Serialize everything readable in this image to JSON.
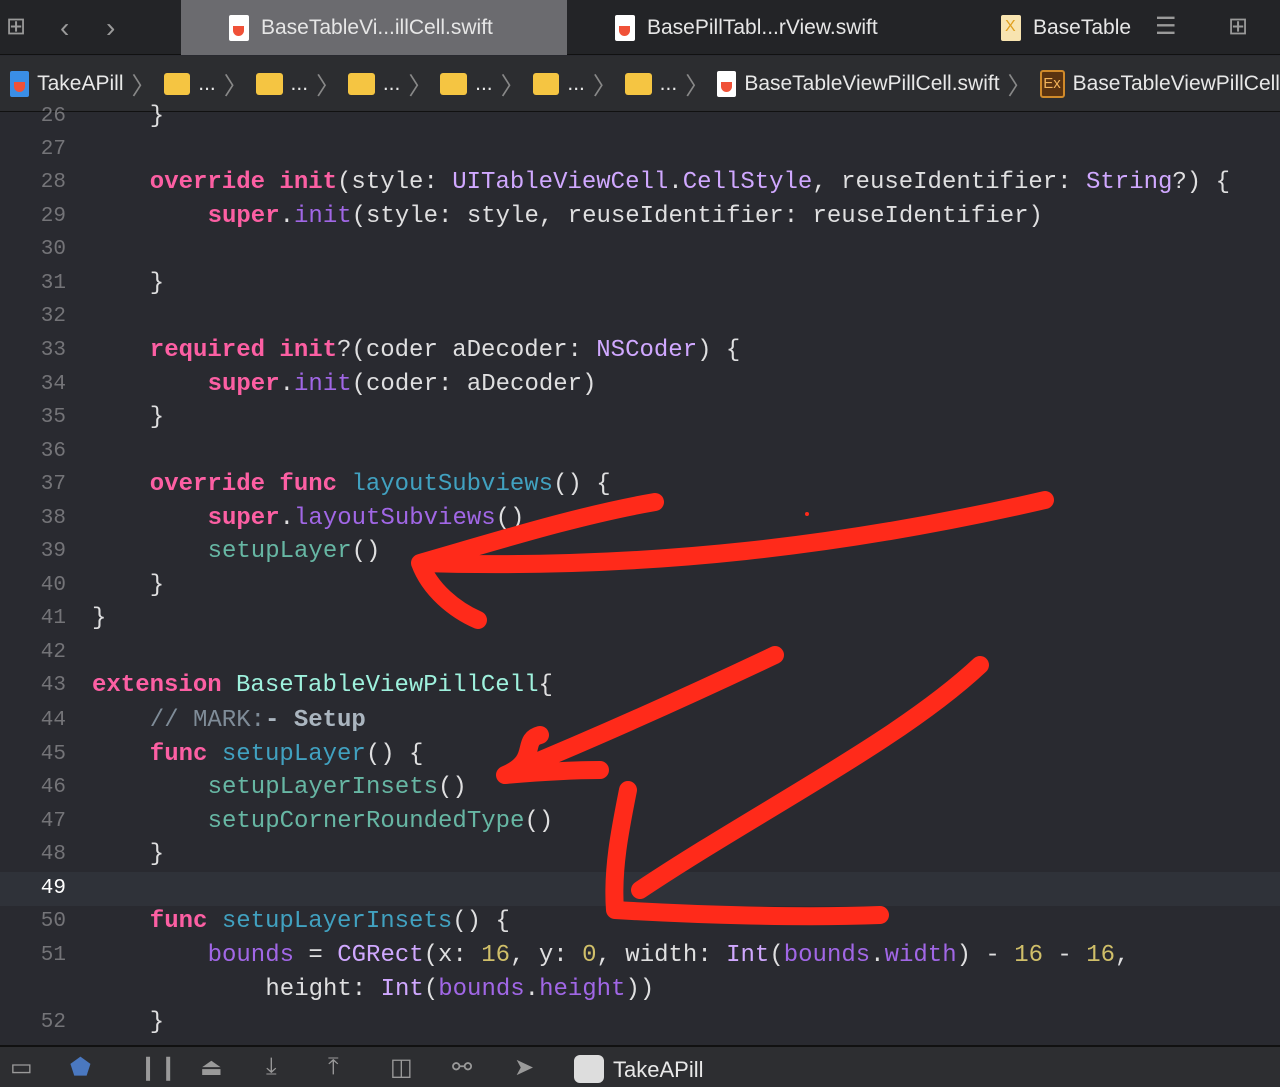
{
  "tabs": [
    {
      "label": "BaseTableVi...illCell.swift",
      "active": true
    },
    {
      "label": "BasePillTabl...rView.swift"
    },
    {
      "label": "BaseTable"
    }
  ],
  "breadcrumb": {
    "project": "TakeAPill",
    "folders": [
      "...",
      "...",
      "...",
      "...",
      "...",
      "..."
    ],
    "file": "BaseTableViewPillCell.swift",
    "symbol_badge": "Ex",
    "symbol": "BaseTableViewPillCell"
  },
  "code": {
    "lines": [
      {
        "n": "26",
        "html": "    }"
      },
      {
        "n": "27",
        "html": ""
      },
      {
        "n": "28",
        "html": "    <span class='k'>override</span> <span class='k'>init</span>(style: <span class='t'>UITableViewCell</span>.<span class='t'>CellStyle</span>, reuseIdentifier: <span class='t'>String</span>?) {"
      },
      {
        "n": "29",
        "html": "        <span class='k'>super</span>.<span class='s'>init</span>(style: style, reuseIdentifier: reuseIdentifier)"
      },
      {
        "n": "30",
        "html": ""
      },
      {
        "n": "31",
        "html": "    }"
      },
      {
        "n": "32",
        "html": ""
      },
      {
        "n": "33",
        "html": "    <span class='k'>required</span> <span class='k'>init</span>?(coder aDecoder: <span class='t'>NSCoder</span>) {"
      },
      {
        "n": "34",
        "html": "        <span class='k'>super</span>.<span class='s'>init</span>(coder: aDecoder)"
      },
      {
        "n": "35",
        "html": "    }"
      },
      {
        "n": "36",
        "html": ""
      },
      {
        "n": "37",
        "html": "    <span class='k'>override</span> <span class='k'>func</span> <span class='d'>layoutSubviews</span>() {"
      },
      {
        "n": "38",
        "html": "        <span class='k'>super</span>.<span class='s'>layoutSubviews</span>()"
      },
      {
        "n": "39",
        "html": "        <span class='f'>setupLayer</span>()"
      },
      {
        "n": "40",
        "html": "    }"
      },
      {
        "n": "41",
        "html": "}"
      },
      {
        "n": "42",
        "html": ""
      },
      {
        "n": "43",
        "html": "<span class='k'>extension</span> <span class='pt'>BaseTableViewPillCell</span>{"
      },
      {
        "n": "44",
        "html": "    <span class='c'>// MARK:</span><span class='cb'>- Setup</span>"
      },
      {
        "n": "45",
        "html": "    <span class='k'>func</span> <span class='d'>setupLayer</span>() {"
      },
      {
        "n": "46",
        "html": "        <span class='f'>setupLayerInsets</span>()"
      },
      {
        "n": "47",
        "html": "        <span class='f'>setupCornerRoundedType</span>()"
      },
      {
        "n": "48",
        "html": "    }"
      },
      {
        "n": "49",
        "html": "",
        "current": true
      },
      {
        "n": "50",
        "html": "    <span class='k'>func</span> <span class='d'>setupLayerInsets</span>() {"
      },
      {
        "n": "51",
        "html": "        <span class='s'>bounds</span> = <span class='t'>CGRect</span>(x: <span class='n'>16</span>, y: <span class='n'>0</span>, width: <span class='t'>Int</span>(<span class='s'>bounds</span>.<span class='s'>width</span>) - <span class='n'>16</span> - <span class='n'>16</span>,"
      },
      {
        "n": "",
        "html": "            height: <span class='t'>Int</span>(<span class='s'>bounds</span>.<span class='s'>height</span>))"
      },
      {
        "n": "52",
        "html": "    }"
      }
    ]
  },
  "bottom": {
    "scheme": "TakeAPill"
  },
  "colors": {
    "keyword": "#fc5fa3",
    "annotation": "#ff2a1a",
    "background": "#292a30"
  }
}
